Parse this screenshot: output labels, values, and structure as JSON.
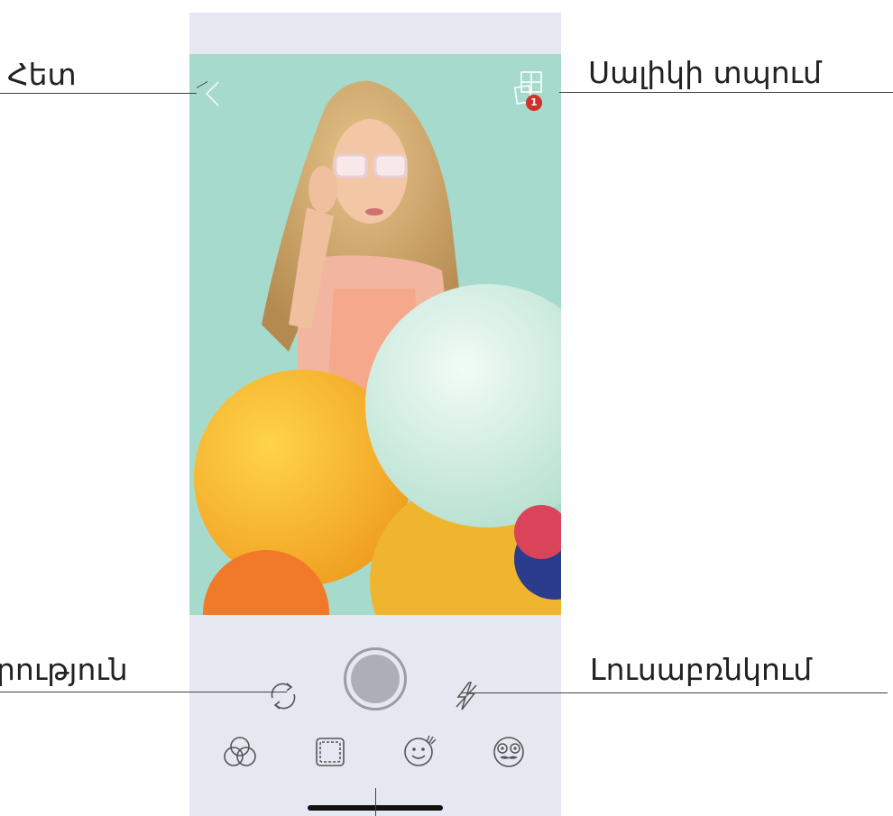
{
  "callouts": {
    "back": "Հետ",
    "print_queue": "Սալիկի տպում",
    "switch_camera": "րություն",
    "flash": "Լուսաբռնկում"
  },
  "toolbar": {
    "badge_count": "1"
  },
  "icons": {
    "back": "chevron-left-icon",
    "print_queue": "tile-print-icon",
    "switch_camera": "camera-rotate-icon",
    "flash": "flash-off-icon",
    "filters": "color-filter-icon",
    "borders": "border-frame-icon",
    "stickers": "sticker-smiley-icon",
    "ar": "ar-face-icon"
  },
  "colors": {
    "badge": "#d0312d",
    "background": "#e6e8f1",
    "photo_wall": "#a3d9cb"
  }
}
